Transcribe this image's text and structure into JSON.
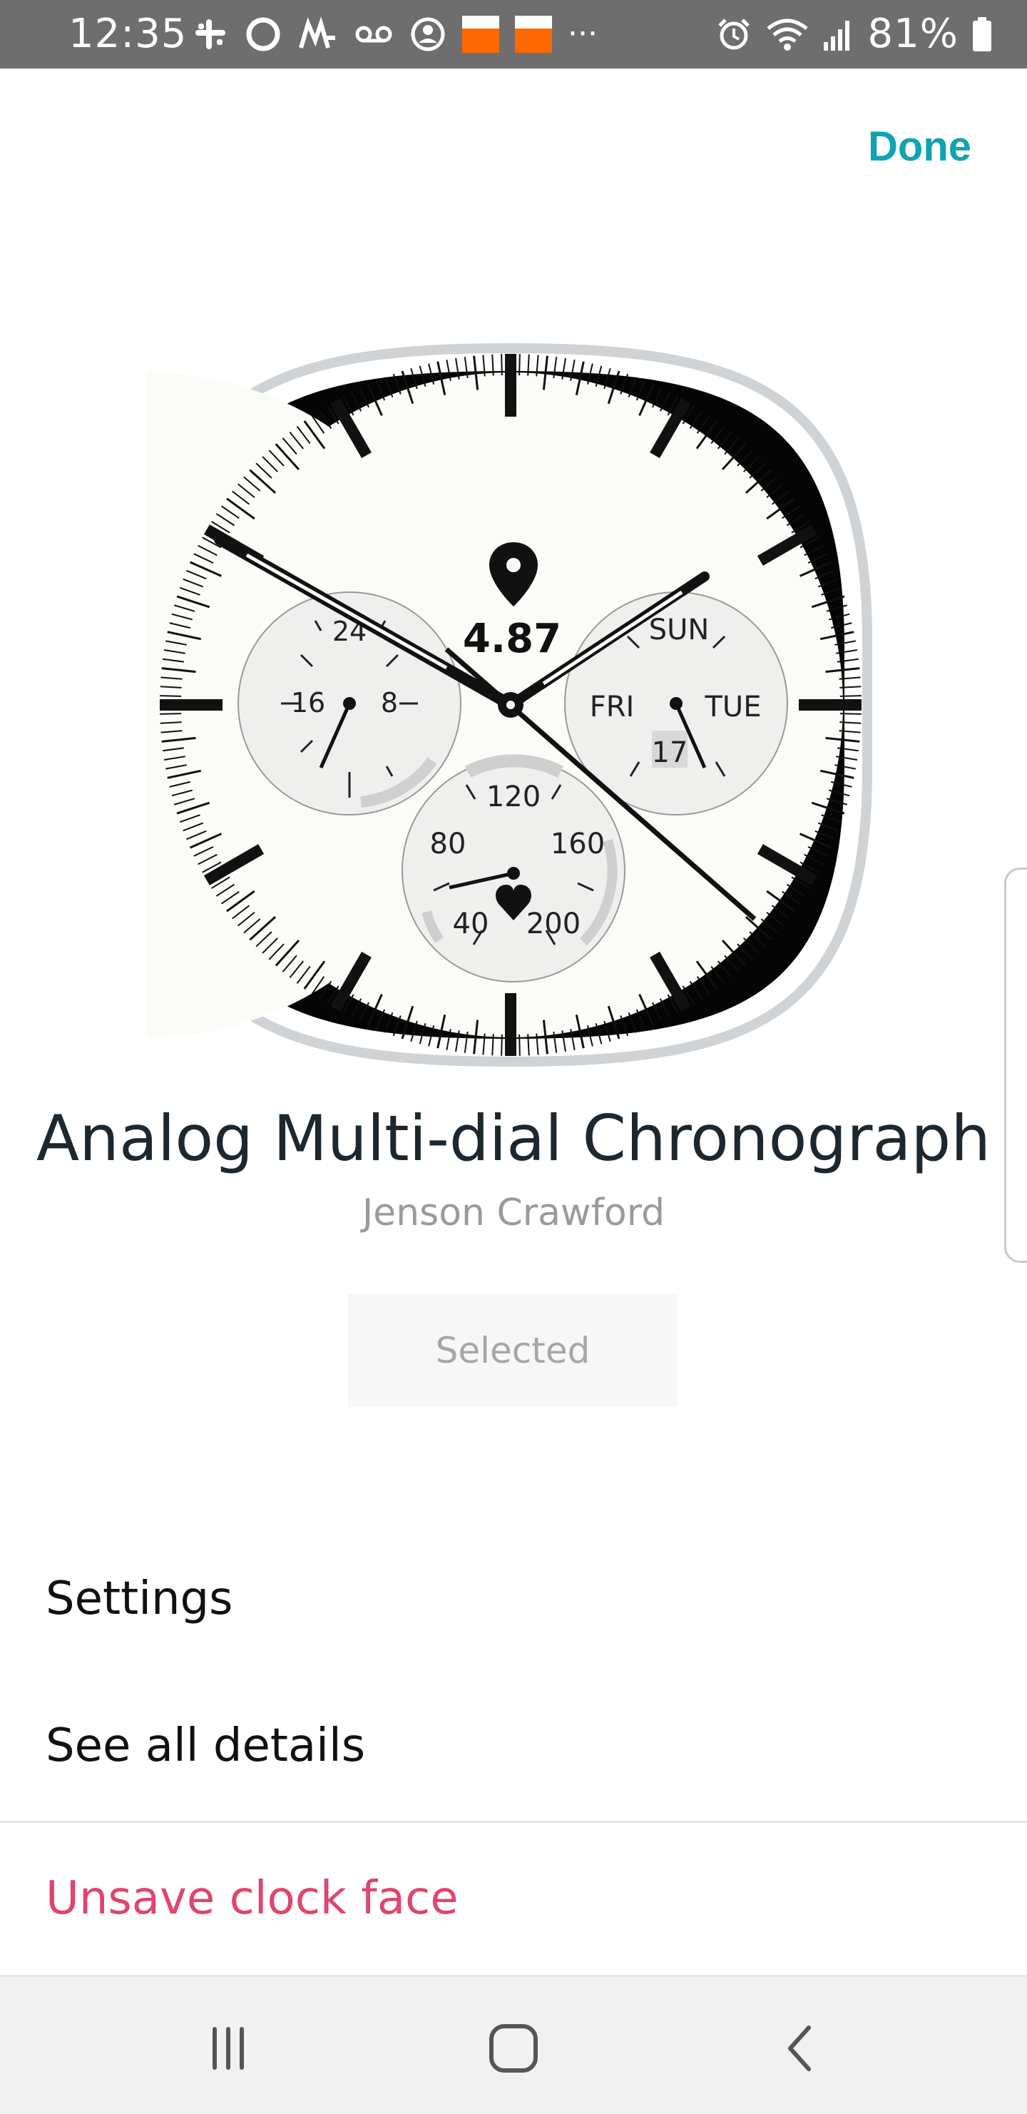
{
  "status_bar": {
    "time": "12:35",
    "overflow": "···",
    "battery": "81%",
    "icons_left": [
      "slack-icon",
      "circle-app-icon",
      "m-app-icon",
      "voicemail-icon",
      "account-icon",
      "discover-icon",
      "discover-icon"
    ],
    "icons_right": [
      "alarm-icon",
      "wifi-icon",
      "signal-icon",
      "battery-icon"
    ]
  },
  "header": {
    "done_label": "Done"
  },
  "watch": {
    "distance": "4.87",
    "top_dial": [
      "24",
      "16",
      "8"
    ],
    "day_dial": {
      "top": "SUN",
      "left": "FRI",
      "right": "TUE",
      "date": "17"
    },
    "hr_dial": [
      "120",
      "80",
      "160",
      "40",
      "200"
    ]
  },
  "face": {
    "title": "Analog Multi-dial Chronograph",
    "author": "Jenson Crawford",
    "button_label": "Selected"
  },
  "menu": {
    "settings": "Settings",
    "details": "See all details",
    "unsave": "Unsave clock face"
  },
  "colors": {
    "accent": "#10a3b3",
    "destructive": "#e0456d"
  }
}
